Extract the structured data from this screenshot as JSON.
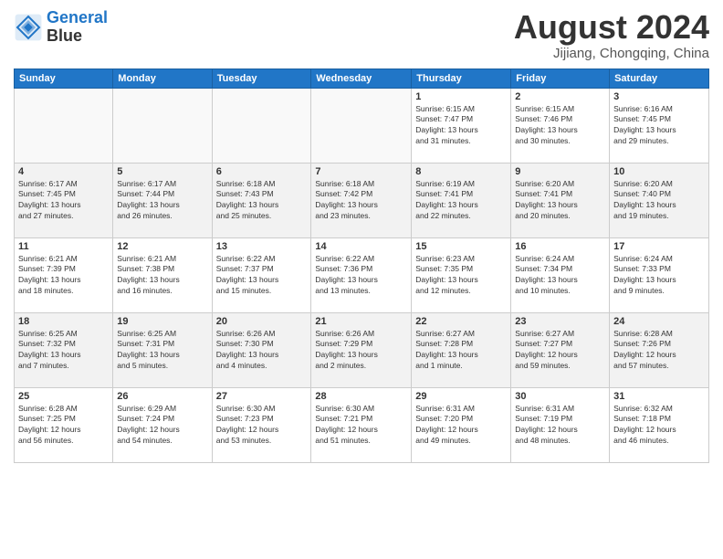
{
  "logo": {
    "line1": "General",
    "line2": "Blue"
  },
  "title": "August 2024",
  "subtitle": "Jijiang, Chongqing, China",
  "days_header": [
    "Sunday",
    "Monday",
    "Tuesday",
    "Wednesday",
    "Thursday",
    "Friday",
    "Saturday"
  ],
  "weeks": [
    [
      {
        "day": "",
        "info": ""
      },
      {
        "day": "",
        "info": ""
      },
      {
        "day": "",
        "info": ""
      },
      {
        "day": "",
        "info": ""
      },
      {
        "day": "1",
        "info": "Sunrise: 6:15 AM\nSunset: 7:47 PM\nDaylight: 13 hours\nand 31 minutes."
      },
      {
        "day": "2",
        "info": "Sunrise: 6:15 AM\nSunset: 7:46 PM\nDaylight: 13 hours\nand 30 minutes."
      },
      {
        "day": "3",
        "info": "Sunrise: 6:16 AM\nSunset: 7:45 PM\nDaylight: 13 hours\nand 29 minutes."
      }
    ],
    [
      {
        "day": "4",
        "info": "Sunrise: 6:17 AM\nSunset: 7:45 PM\nDaylight: 13 hours\nand 27 minutes."
      },
      {
        "day": "5",
        "info": "Sunrise: 6:17 AM\nSunset: 7:44 PM\nDaylight: 13 hours\nand 26 minutes."
      },
      {
        "day": "6",
        "info": "Sunrise: 6:18 AM\nSunset: 7:43 PM\nDaylight: 13 hours\nand 25 minutes."
      },
      {
        "day": "7",
        "info": "Sunrise: 6:18 AM\nSunset: 7:42 PM\nDaylight: 13 hours\nand 23 minutes."
      },
      {
        "day": "8",
        "info": "Sunrise: 6:19 AM\nSunset: 7:41 PM\nDaylight: 13 hours\nand 22 minutes."
      },
      {
        "day": "9",
        "info": "Sunrise: 6:20 AM\nSunset: 7:41 PM\nDaylight: 13 hours\nand 20 minutes."
      },
      {
        "day": "10",
        "info": "Sunrise: 6:20 AM\nSunset: 7:40 PM\nDaylight: 13 hours\nand 19 minutes."
      }
    ],
    [
      {
        "day": "11",
        "info": "Sunrise: 6:21 AM\nSunset: 7:39 PM\nDaylight: 13 hours\nand 18 minutes."
      },
      {
        "day": "12",
        "info": "Sunrise: 6:21 AM\nSunset: 7:38 PM\nDaylight: 13 hours\nand 16 minutes."
      },
      {
        "day": "13",
        "info": "Sunrise: 6:22 AM\nSunset: 7:37 PM\nDaylight: 13 hours\nand 15 minutes."
      },
      {
        "day": "14",
        "info": "Sunrise: 6:22 AM\nSunset: 7:36 PM\nDaylight: 13 hours\nand 13 minutes."
      },
      {
        "day": "15",
        "info": "Sunrise: 6:23 AM\nSunset: 7:35 PM\nDaylight: 13 hours\nand 12 minutes."
      },
      {
        "day": "16",
        "info": "Sunrise: 6:24 AM\nSunset: 7:34 PM\nDaylight: 13 hours\nand 10 minutes."
      },
      {
        "day": "17",
        "info": "Sunrise: 6:24 AM\nSunset: 7:33 PM\nDaylight: 13 hours\nand 9 minutes."
      }
    ],
    [
      {
        "day": "18",
        "info": "Sunrise: 6:25 AM\nSunset: 7:32 PM\nDaylight: 13 hours\nand 7 minutes."
      },
      {
        "day": "19",
        "info": "Sunrise: 6:25 AM\nSunset: 7:31 PM\nDaylight: 13 hours\nand 5 minutes."
      },
      {
        "day": "20",
        "info": "Sunrise: 6:26 AM\nSunset: 7:30 PM\nDaylight: 13 hours\nand 4 minutes."
      },
      {
        "day": "21",
        "info": "Sunrise: 6:26 AM\nSunset: 7:29 PM\nDaylight: 13 hours\nand 2 minutes."
      },
      {
        "day": "22",
        "info": "Sunrise: 6:27 AM\nSunset: 7:28 PM\nDaylight: 13 hours\nand 1 minute."
      },
      {
        "day": "23",
        "info": "Sunrise: 6:27 AM\nSunset: 7:27 PM\nDaylight: 12 hours\nand 59 minutes."
      },
      {
        "day": "24",
        "info": "Sunrise: 6:28 AM\nSunset: 7:26 PM\nDaylight: 12 hours\nand 57 minutes."
      }
    ],
    [
      {
        "day": "25",
        "info": "Sunrise: 6:28 AM\nSunset: 7:25 PM\nDaylight: 12 hours\nand 56 minutes."
      },
      {
        "day": "26",
        "info": "Sunrise: 6:29 AM\nSunset: 7:24 PM\nDaylight: 12 hours\nand 54 minutes."
      },
      {
        "day": "27",
        "info": "Sunrise: 6:30 AM\nSunset: 7:23 PM\nDaylight: 12 hours\nand 53 minutes."
      },
      {
        "day": "28",
        "info": "Sunrise: 6:30 AM\nSunset: 7:21 PM\nDaylight: 12 hours\nand 51 minutes."
      },
      {
        "day": "29",
        "info": "Sunrise: 6:31 AM\nSunset: 7:20 PM\nDaylight: 12 hours\nand 49 minutes."
      },
      {
        "day": "30",
        "info": "Sunrise: 6:31 AM\nSunset: 7:19 PM\nDaylight: 12 hours\nand 48 minutes."
      },
      {
        "day": "31",
        "info": "Sunrise: 6:32 AM\nSunset: 7:18 PM\nDaylight: 12 hours\nand 46 minutes."
      }
    ]
  ]
}
